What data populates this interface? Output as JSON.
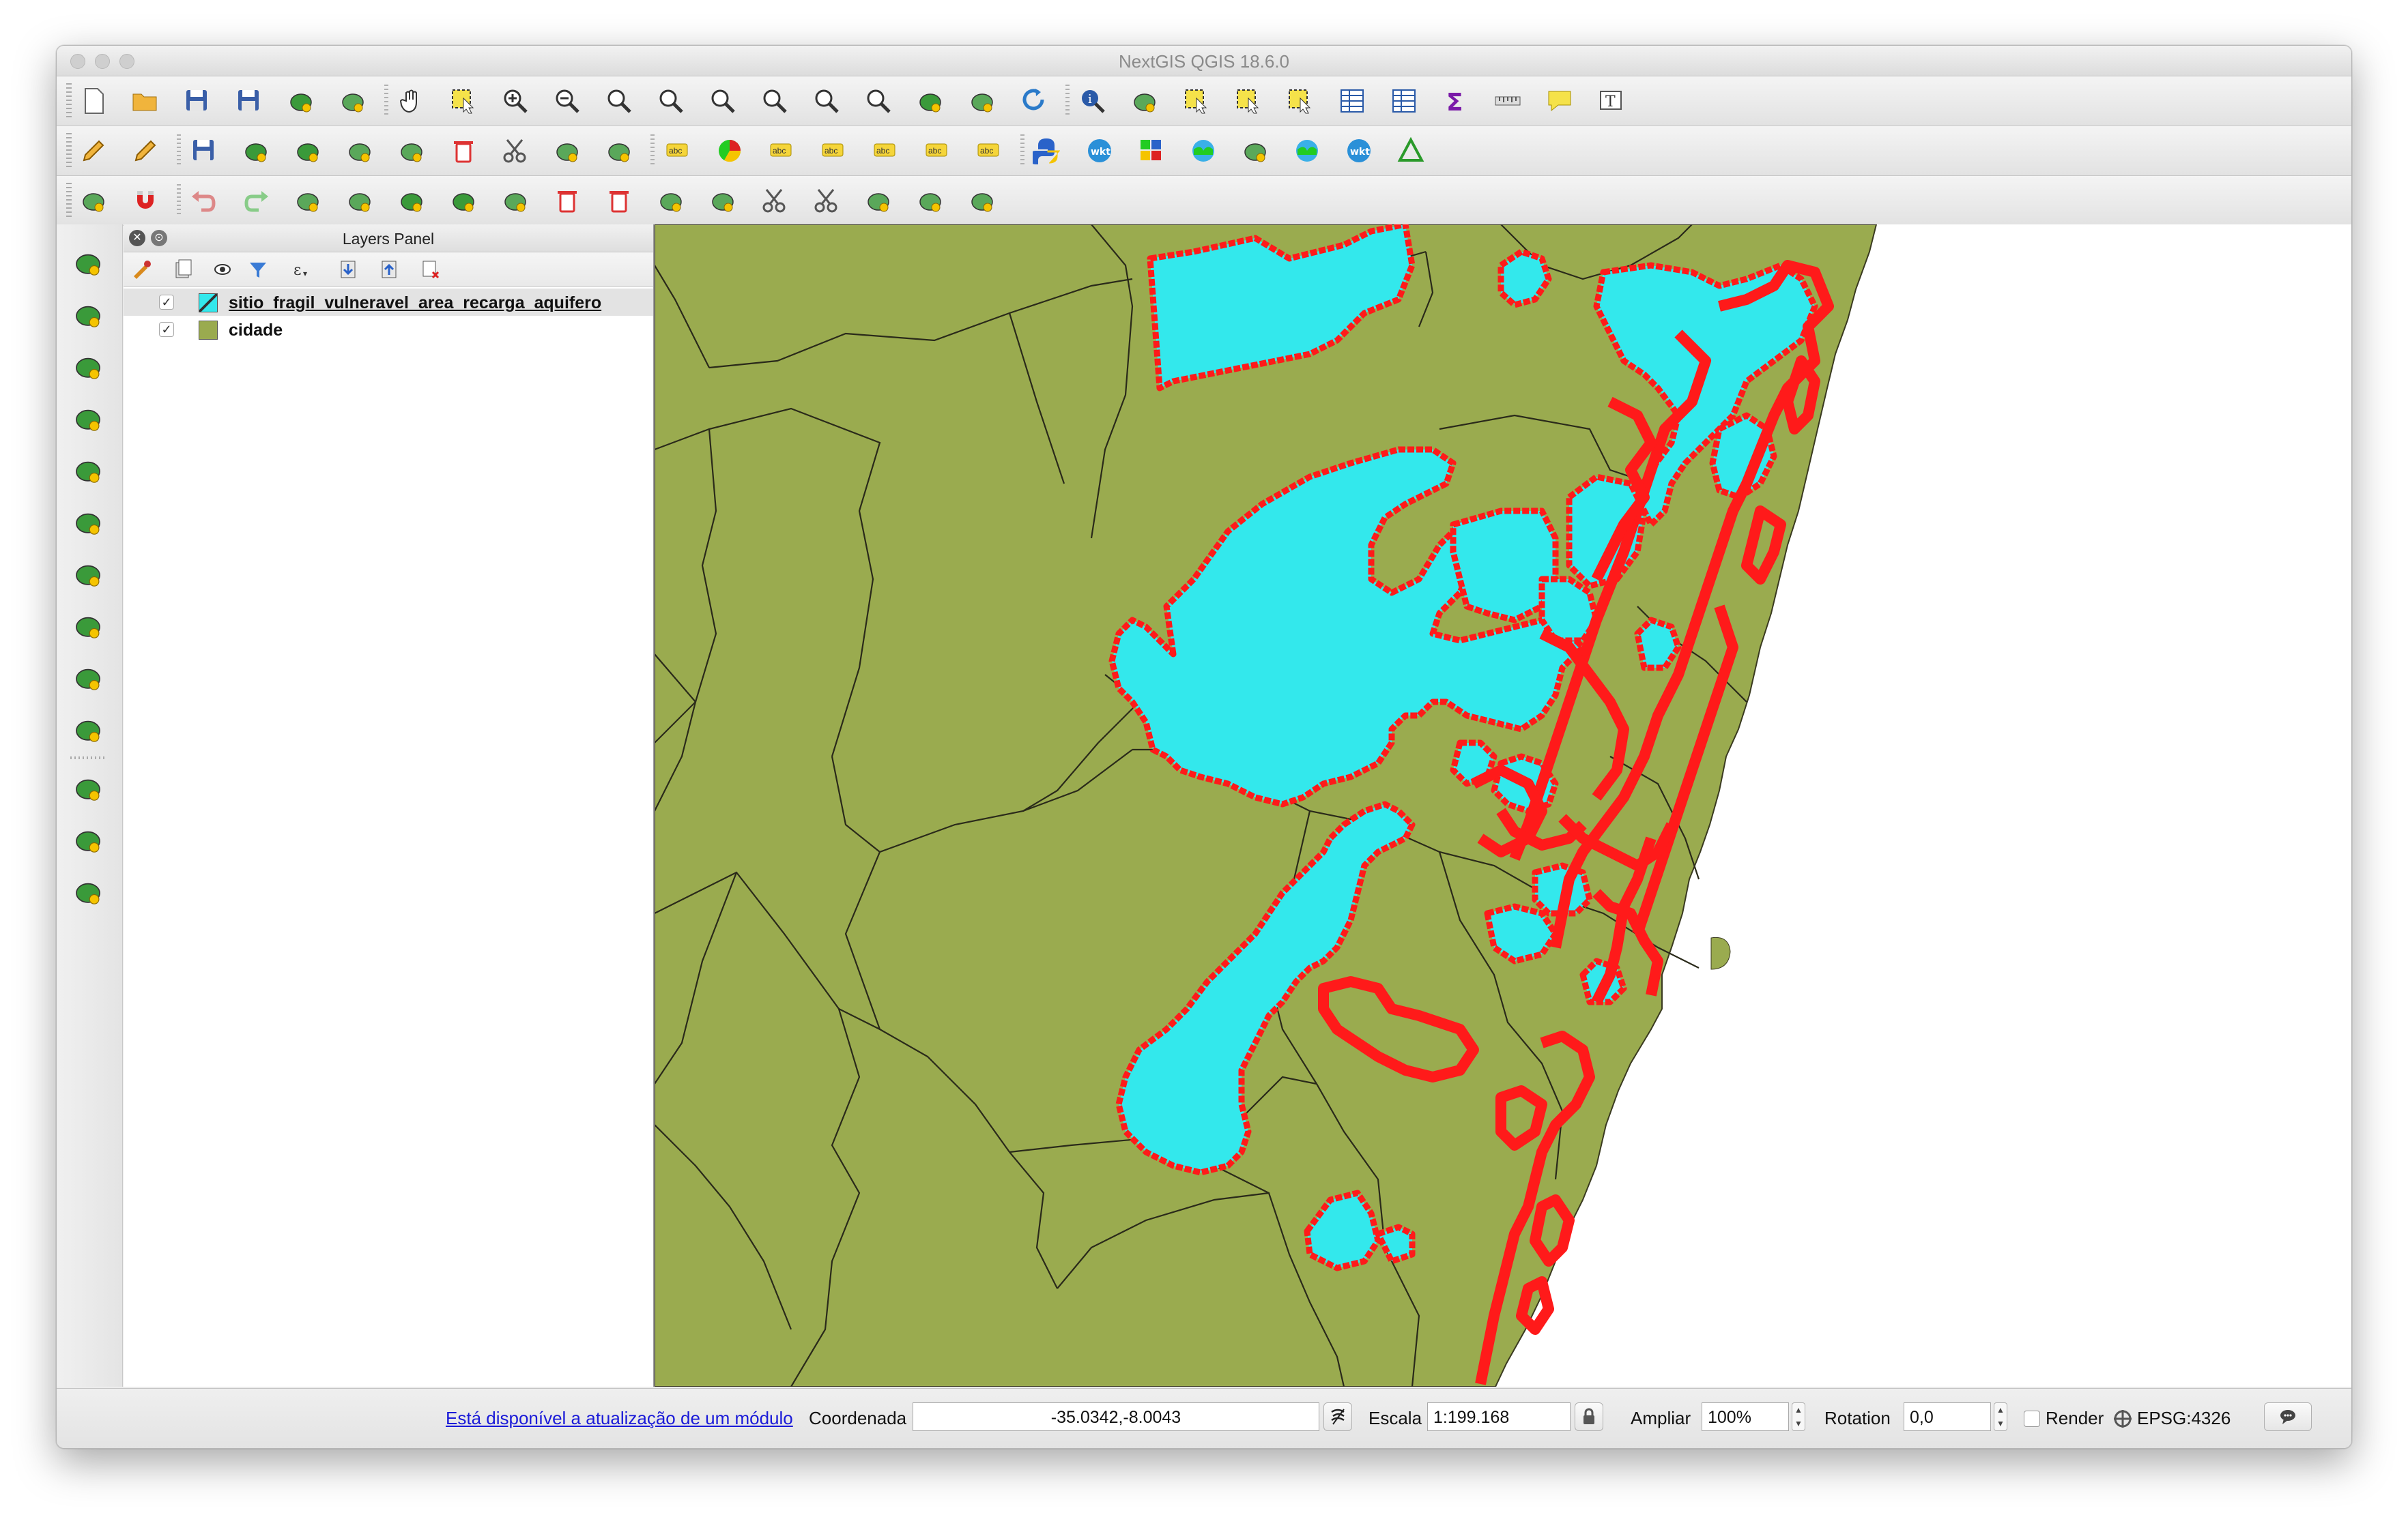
{
  "window": {
    "title": "NextGIS QGIS 18.6.0"
  },
  "toolbars": {
    "row1": [
      "new-project-icon",
      "open-folder-icon",
      "save-icon",
      "save-as-icon",
      "new-print-layout-icon",
      "print-manager-icon",
      "pan-hand-icon",
      "pan-to-selection-icon",
      "zoom-in-icon",
      "zoom-out-icon",
      "zoom-native-icon",
      "zoom-full-icon",
      "zoom-to-selection-icon",
      "zoom-to-layer-icon",
      "zoom-last-icon",
      "zoom-next-icon",
      "new-bookmark-icon",
      "show-bookmarks-icon",
      "refresh-icon",
      "identify-icon",
      "action-icon",
      "select-features-icon",
      "select-expression-icon",
      "deselect-icon",
      "attribute-table-icon",
      "field-calculator-icon",
      "statistics-sigma-icon",
      "measure-icon",
      "map-tips-icon",
      "text-annotation-icon"
    ],
    "row2": [
      "current-edits-icon",
      "toggle-editing-pencil-icon",
      "save-edits-icon",
      "add-feature-icon",
      "add-ring-icon",
      "move-feature-icon",
      "node-tool-icon",
      "delete-selected-icon",
      "cut-features-icon",
      "copy-features-icon",
      "paste-features-icon",
      "label-icon",
      "diagram-icon",
      "pin-label-icon",
      "show-hide-label-icon",
      "move-label-icon",
      "rotate-label-icon",
      "change-label-icon",
      "python-console-icon",
      "wkt-icon",
      "quickmapservices-icon",
      "qgis-cloud-icon",
      "google-search-icon",
      "plugin-globe-icon",
      "wkt-editor-icon",
      "geometry-checker-icon"
    ],
    "row3": [
      "snapping-tool-icon",
      "magnet-icon",
      "undo-icon",
      "redo-icon",
      "rotate-feature-icon",
      "simplify-icon",
      "add-ring-advanced-icon",
      "add-part-icon",
      "fill-ring-icon",
      "delete-ring-icon",
      "delete-part-icon",
      "reshape-icon",
      "offset-curve-icon",
      "split-features-icon",
      "split-parts-icon",
      "merge-features-icon",
      "merge-attributes-icon",
      "rotate-point-symbols-icon"
    ]
  },
  "left_toolbar": [
    "add-vector-layer-icon",
    "add-raster-layer-icon",
    "add-spatialite-icon",
    "add-postgis-icon",
    "add-wms-icon",
    "add-wcs-icon",
    "add-wfs-icon",
    "add-delimited-text-icon",
    "add-virtual-layer-icon",
    "add-mssql-icon",
    "new-shapefile-icon",
    "new-spatialite-icon",
    "new-temporary-layer-icon"
  ],
  "layers_panel": {
    "title": "Layers Panel",
    "layers": [
      {
        "name": "sitio_fragil_vulneravel_area_recarga_aquifero",
        "checked": "✓",
        "swatch": "#33e8ec",
        "selected": true
      },
      {
        "name": "cidade",
        "checked": "✓",
        "swatch": "#9aab4f",
        "selected": false
      }
    ]
  },
  "map": {
    "land_color": "#9aab4f",
    "water_color": "#33e8ec",
    "outline_color": "#ff1a1a",
    "background_color": "#ffffff"
  },
  "statusbar": {
    "update_link": "Está disponível a atualização de um módulo",
    "coord_label": "Coordenada",
    "coord_value": "-35.0342,-8.0043",
    "scale_label": "Escala",
    "scale_value": "1:199.168",
    "magnify_label": "Ampliar",
    "magnify_value": "100%",
    "rotation_label": "Rotation",
    "rotation_value": "0,0",
    "render_label": "Render",
    "crs_label": "EPSG:4326"
  }
}
